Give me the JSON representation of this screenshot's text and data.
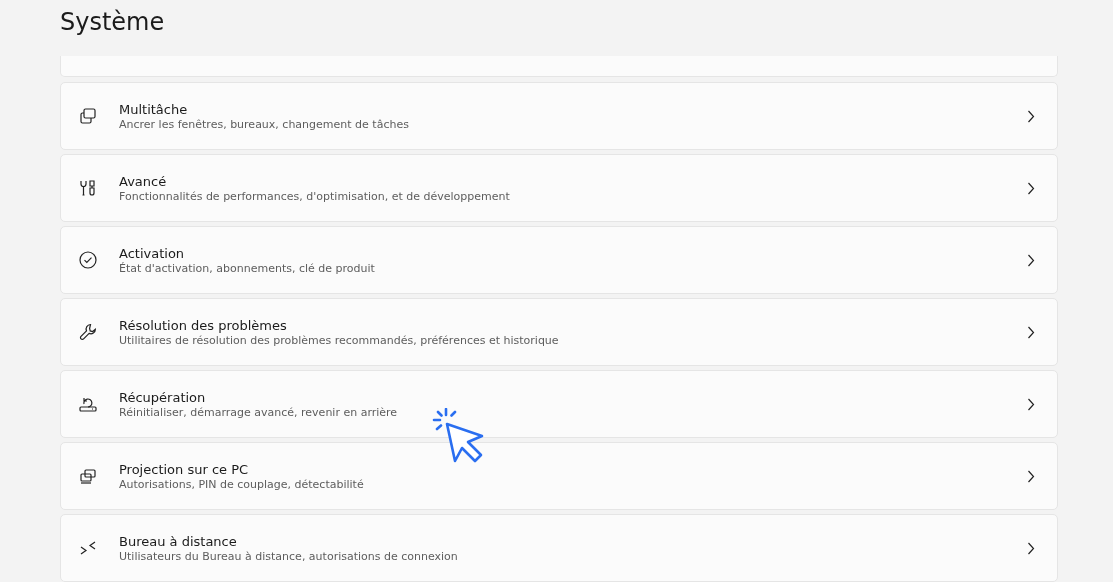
{
  "header": {
    "title": "Système"
  },
  "items": [
    {
      "title": "Multitâche",
      "subtitle": "Ancrer les fenêtres, bureaux, changement de tâches"
    },
    {
      "title": "Avancé",
      "subtitle": "Fonctionnalités de performances, d'optimisation, et de développement"
    },
    {
      "title": "Activation",
      "subtitle": "État d'activation, abonnements, clé de produit"
    },
    {
      "title": "Résolution des problèmes",
      "subtitle": "Utilitaires de résolution des problèmes recommandés, préférences et historique"
    },
    {
      "title": "Récupération",
      "subtitle": "Réinitialiser, démarrage avancé, revenir en arrière"
    },
    {
      "title": "Projection sur ce PC",
      "subtitle": "Autorisations, PIN de couplage, détectabilité"
    },
    {
      "title": "Bureau à distance",
      "subtitle": "Utilisateurs du Bureau à distance, autorisations de connexion"
    }
  ],
  "pointer": {
    "shown": true
  }
}
